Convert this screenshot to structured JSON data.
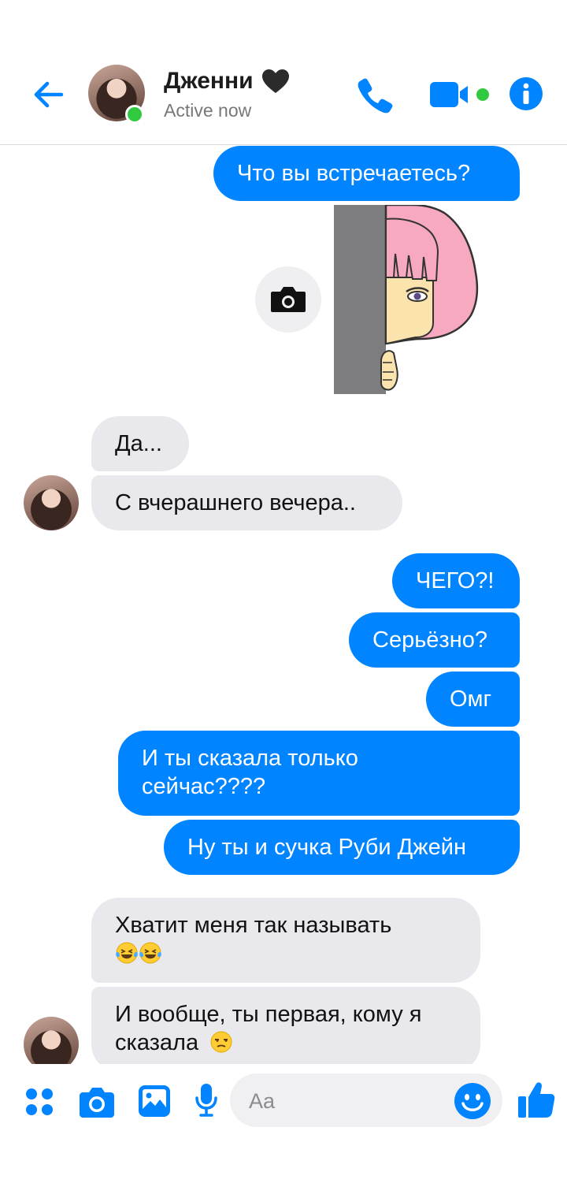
{
  "header": {
    "contact_name": "Дженни",
    "status": "Active now",
    "accent_color": "#0084ff",
    "online_color": "#31c940"
  },
  "messages": [
    {
      "side": "out",
      "text": "Что вы встречаетесь?"
    },
    {
      "side": "out",
      "type": "sticker",
      "icon": "peeking-girl-sticker"
    },
    {
      "side": "in",
      "text": "Да..."
    },
    {
      "side": "in",
      "text": "С вчерашнего вечера.."
    },
    {
      "side": "out",
      "text": "ЧЕГО?!"
    },
    {
      "side": "out",
      "text": "Серьёзно?"
    },
    {
      "side": "out",
      "text": "Омг"
    },
    {
      "side": "out",
      "lines": [
        "И ты сказала только",
        "сейчас????"
      ]
    },
    {
      "side": "out",
      "text": "Ну ты и сучка Руби Джейн"
    },
    {
      "side": "in",
      "lines": [
        "Хватит меня так называть",
        ""
      ],
      "emoji": [
        "laughing-tears-emoji",
        "laughing-tears-emoji"
      ]
    },
    {
      "side": "in",
      "lines": [
        "И вообще, ты первая, кому я",
        "сказала"
      ],
      "emoji": [
        "unamused-face-emoji"
      ]
    }
  ],
  "composer": {
    "placeholder": "Aa",
    "icons": [
      "apps-icon",
      "camera-icon",
      "gallery-icon",
      "microphone-icon",
      "emoji-icon",
      "thumbs-up-icon"
    ]
  }
}
